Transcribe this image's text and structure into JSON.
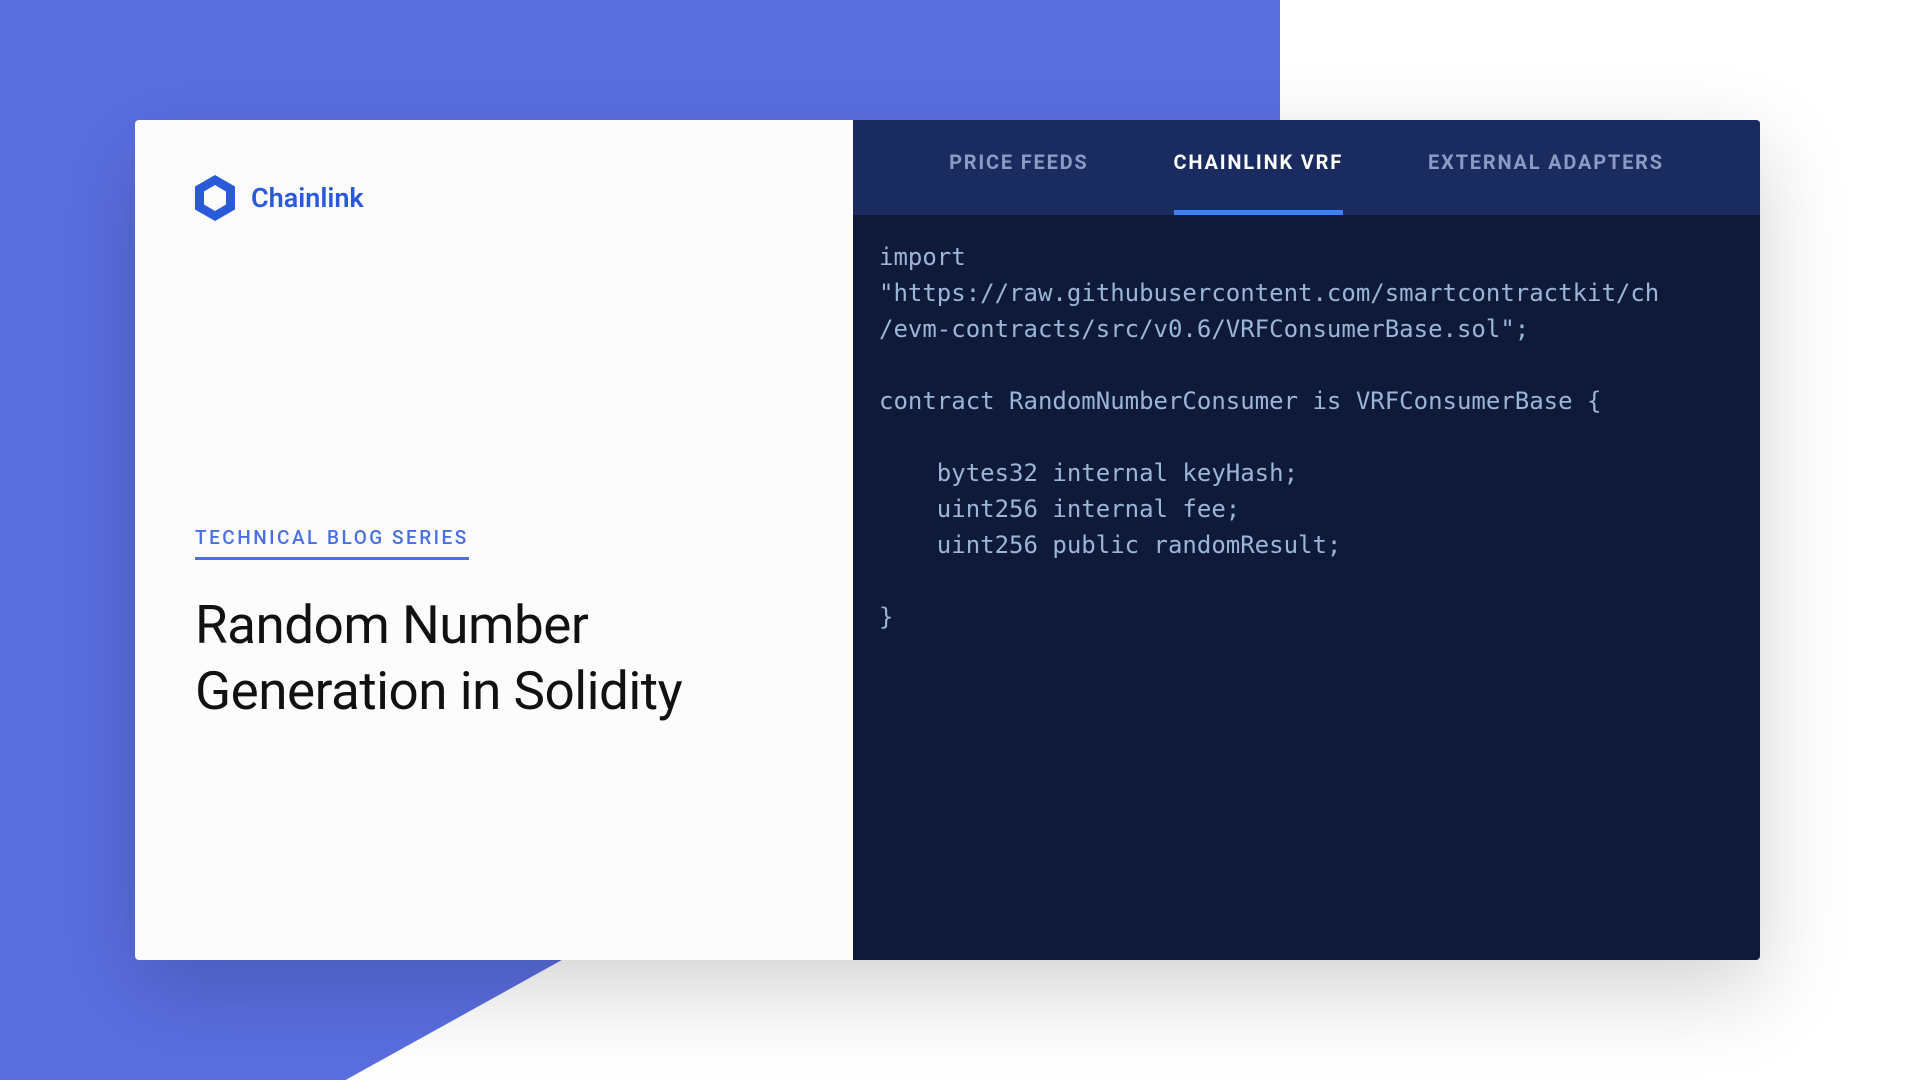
{
  "brand": {
    "name": "Chainlink"
  },
  "left": {
    "series_label": "TECHNICAL BLOG SERIES",
    "title_line1": "Random Number",
    "title_line2": "Generation in Solidity"
  },
  "tabs": [
    {
      "label": "PRICE FEEDS",
      "active": false
    },
    {
      "label": "CHAINLINK VRF",
      "active": true
    },
    {
      "label": "EXTERNAL ADAPTERS",
      "active": false
    }
  ],
  "code": {
    "line1": "import",
    "line2": "\"https://raw.githubusercontent.com/smartcontractkit/ch",
    "line3": "/evm-contracts/src/v0.6/VRFConsumerBase.sol\";",
    "line4": "",
    "line5": "contract RandomNumberConsumer is VRFConsumerBase {",
    "line6": "",
    "line7": "    bytes32 internal keyHash;",
    "line8": "    uint256 internal fee;",
    "line9": "    uint256 public randomResult;",
    "line10": "",
    "line11": "}"
  },
  "colors": {
    "bg_shape": "#5a6ee0",
    "tab_bar": "#1a2b5f",
    "code_bg": "#0f1a3a",
    "accent": "#3b82f6",
    "brand": "#2a5ada"
  }
}
